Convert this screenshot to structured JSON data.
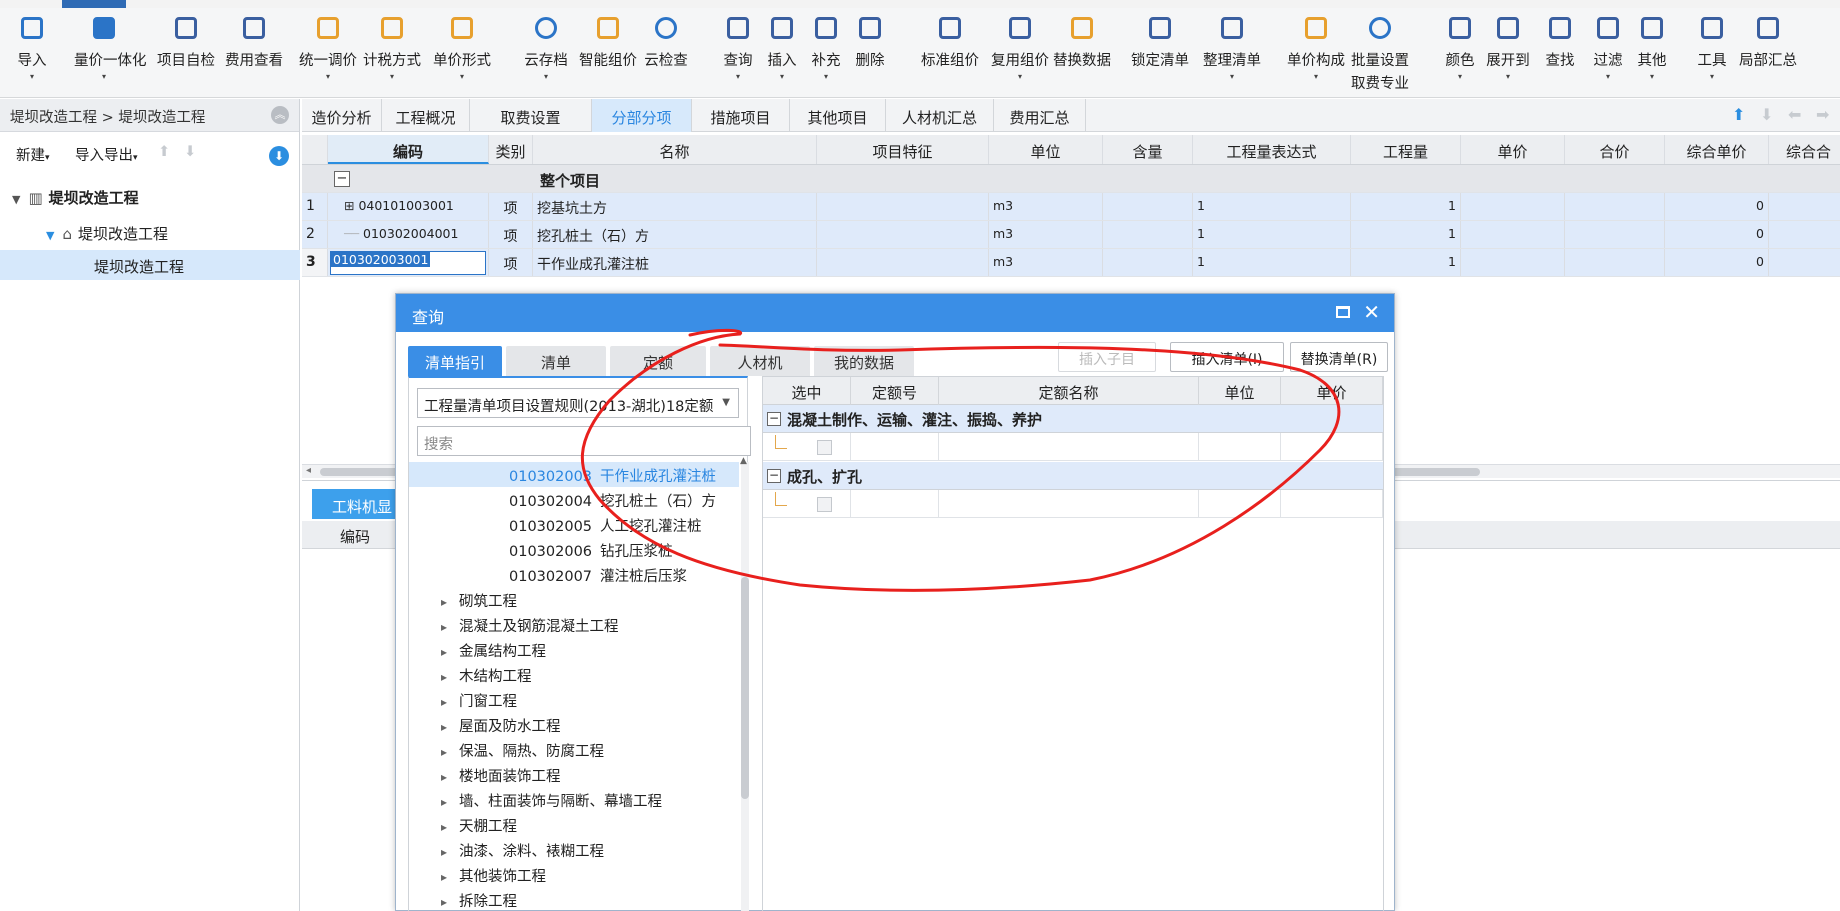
{
  "ribbon": {
    "buttons": [
      {
        "label": "导入",
        "icon": "import-icon"
      },
      {
        "label": "量价一体化",
        "icon": "quantity-price-icon"
      },
      {
        "label": "项目自检",
        "icon": "self-check-icon"
      },
      {
        "label": "费用查看",
        "icon": "fee-view-icon"
      },
      {
        "label": "统一调价",
        "icon": "adjust-price-icon"
      },
      {
        "label": "计税方式",
        "icon": "tax-method-icon"
      },
      {
        "label": "单价形式",
        "icon": "unit-price-form-icon"
      },
      {
        "label": "云存档",
        "icon": "cloud-archive-icon"
      },
      {
        "label": "智能组价",
        "icon": "smart-pricing-icon"
      },
      {
        "label": "云检查",
        "icon": "cloud-check-icon"
      },
      {
        "label": "查询",
        "icon": "query-icon"
      },
      {
        "label": "插入",
        "icon": "insert-icon"
      },
      {
        "label": "补充",
        "icon": "supplement-icon"
      },
      {
        "label": "删除",
        "icon": "delete-icon"
      },
      {
        "label": "标准组价",
        "icon": "standard-pricing-icon"
      },
      {
        "label": "复用组价",
        "icon": "reuse-pricing-icon"
      },
      {
        "label": "替换数据",
        "icon": "replace-data-icon"
      },
      {
        "label": "锁定清单",
        "icon": "lock-list-icon"
      },
      {
        "label": "整理清单",
        "icon": "organize-list-icon"
      },
      {
        "label": "单价构成",
        "icon": "price-composition-icon"
      },
      {
        "label": "批量设置",
        "label2": "取费专业",
        "icon": "batch-setting-icon"
      },
      {
        "label": "颜色",
        "icon": "color-icon"
      },
      {
        "label": "展开到",
        "icon": "expand-to-icon"
      },
      {
        "label": "查找",
        "icon": "find-icon"
      },
      {
        "label": "过滤",
        "icon": "filter-icon"
      },
      {
        "label": "其他",
        "icon": "other-icon"
      },
      {
        "label": "工具",
        "icon": "tools-icon"
      },
      {
        "label": "局部汇总",
        "icon": "partial-summary-icon"
      }
    ]
  },
  "left": {
    "breadcrumb": "堤坝改造工程 > 堤坝改造工程",
    "new_label": "新建",
    "import_export_label": "导入导出",
    "tree": {
      "root": "堤坝改造工程",
      "child": "堤坝改造工程",
      "leaf": "堤坝改造工程"
    }
  },
  "tabs": [
    "造价分析",
    "工程概况",
    "取费设置",
    "分部分项",
    "措施项目",
    "其他项目",
    "人材机汇总",
    "费用汇总"
  ],
  "grid": {
    "headers": [
      "编码",
      "类别",
      "名称",
      "项目特征",
      "单位",
      "含量",
      "工程量表达式",
      "工程量",
      "单价",
      "合价",
      "综合单价",
      "综合合"
    ],
    "whole_label": "整个项目",
    "rows": [
      {
        "num": "1",
        "code": "040101003001",
        "type": "项",
        "name": "挖基坑土方",
        "unit": "m3",
        "expr": "1",
        "qty": "1",
        "total": "0"
      },
      {
        "num": "2",
        "code": "010302004001",
        "type": "项",
        "name": "挖孔桩土（石）方",
        "unit": "m3",
        "expr": "1",
        "qty": "1",
        "total": "0"
      },
      {
        "num": "3",
        "code": "010302003001",
        "type": "项",
        "name": "干作业成孔灌注桩",
        "unit": "m3",
        "expr": "1",
        "qty": "1",
        "total": "0"
      }
    ]
  },
  "bottom": {
    "tab_label": "工料机显示",
    "header_code": "编码"
  },
  "dialog": {
    "title": "查询",
    "tabs": [
      "清单指引",
      "清单",
      "定额",
      "人材机",
      "我的数据"
    ],
    "buttons": {
      "insert_child": "插入子目",
      "insert_list": "插入清单(I)",
      "replace_list": "替换清单(R)"
    },
    "selector_value": "工程量清单项目设置规则(2013-湖北)18定额",
    "search_placeholder": "搜索",
    "tree_items": [
      {
        "code": "010302003",
        "name": "干作业成孔灌注桩",
        "selected": true
      },
      {
        "code": "010302004",
        "name": "挖孔桩土（石）方"
      },
      {
        "code": "010302005",
        "name": "人工挖孔灌注桩"
      },
      {
        "code": "010302006",
        "name": "钻孔压浆桩"
      },
      {
        "code": "010302007",
        "name": "灌注桩后压浆"
      }
    ],
    "categories": [
      "砌筑工程",
      "混凝土及钢筋混凝土工程",
      "金属结构工程",
      "木结构工程",
      "门窗工程",
      "屋面及防水工程",
      "保温、隔热、防腐工程",
      "楼地面装饰工程",
      "墙、柱面装饰与隔断、幕墙工程",
      "天棚工程",
      "油漆、涂料、裱糊工程",
      "其他装饰工程",
      "拆除工程"
    ],
    "right_headers": [
      "选中",
      "定额号",
      "定额名称",
      "单位",
      "单价"
    ],
    "groups": [
      "混凝土制作、运输、灌注、振捣、养护",
      "成孔、扩孔"
    ]
  },
  "colors": {
    "accent": "#3a8ee6",
    "annotation": "#e8201d",
    "row_highlight": "#dfeafa"
  }
}
